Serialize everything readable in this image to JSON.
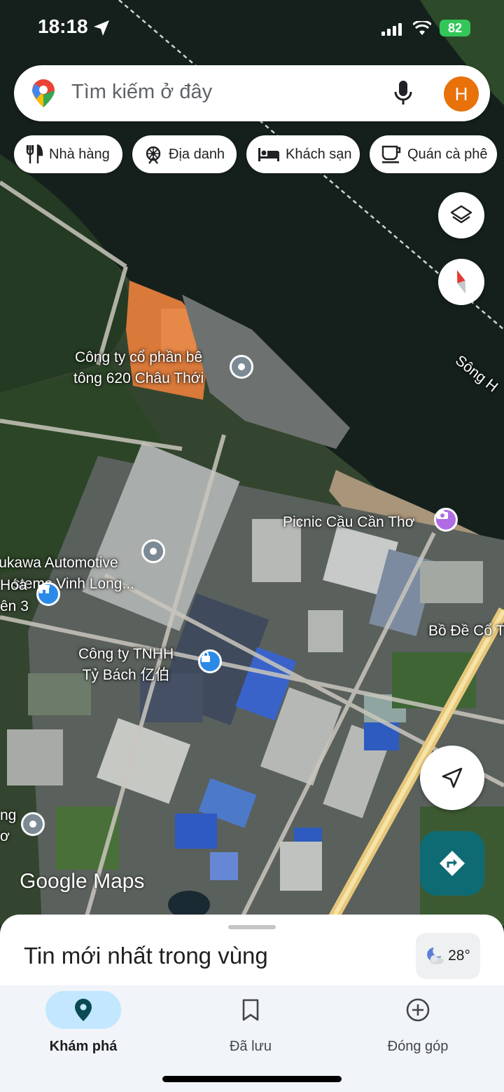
{
  "status_bar": {
    "time": "18:18",
    "battery": "82"
  },
  "search": {
    "placeholder": "Tìm kiếm ở đây",
    "avatar_letter": "H"
  },
  "chips": [
    {
      "label": "Nhà hàng",
      "icon": "restaurant-icon"
    },
    {
      "label": "Địa danh",
      "icon": "attraction-icon"
    },
    {
      "label": "Khách sạn",
      "icon": "hotel-icon"
    },
    {
      "label": "Quán cà phê",
      "icon": "cafe-icon"
    }
  ],
  "map": {
    "labels": {
      "concrete_company": "Công ty cổ phần bê\ntông 620 Châu Thới",
      "picnic": "Picnic Cầu Cần Thơ",
      "yukawa": "ukawa Automotive\nstems Vinh Long...",
      "hoa": "Hóa\nên 3",
      "tnhh": "Công ty TNHH\nTỷ Bách 亿伯",
      "bo_de": "Bồ Đề Cổ T",
      "song": "Sông H",
      "bottom_left": "ng\nơ"
    },
    "logo": "Google Maps"
  },
  "sheet": {
    "title": "Tin mới nhất trong vùng",
    "temperature": "28°"
  },
  "nav": [
    {
      "label": "Khám phá",
      "icon": "explore-pin-icon",
      "active": true
    },
    {
      "label": "Đã lưu",
      "icon": "bookmark-icon",
      "active": false
    },
    {
      "label": "Đóng góp",
      "icon": "add-circle-icon",
      "active": false
    }
  ]
}
